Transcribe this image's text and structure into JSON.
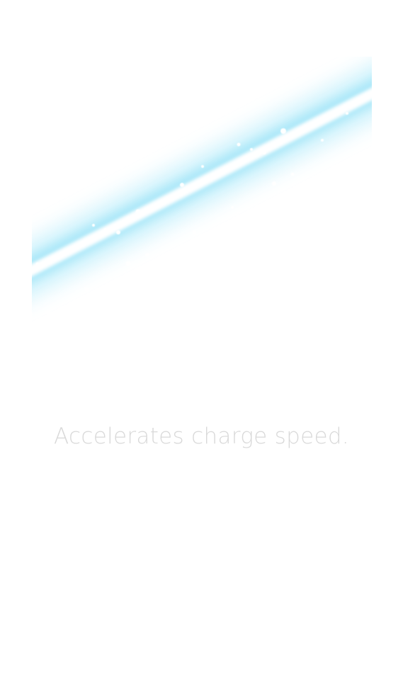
{
  "item": {
    "effect_image": "light-beam-streak-icon",
    "description": "Accelerates charge speed.",
    "beam_colors": {
      "glow": "#b3ecfb",
      "core": "#ffffff"
    }
  }
}
